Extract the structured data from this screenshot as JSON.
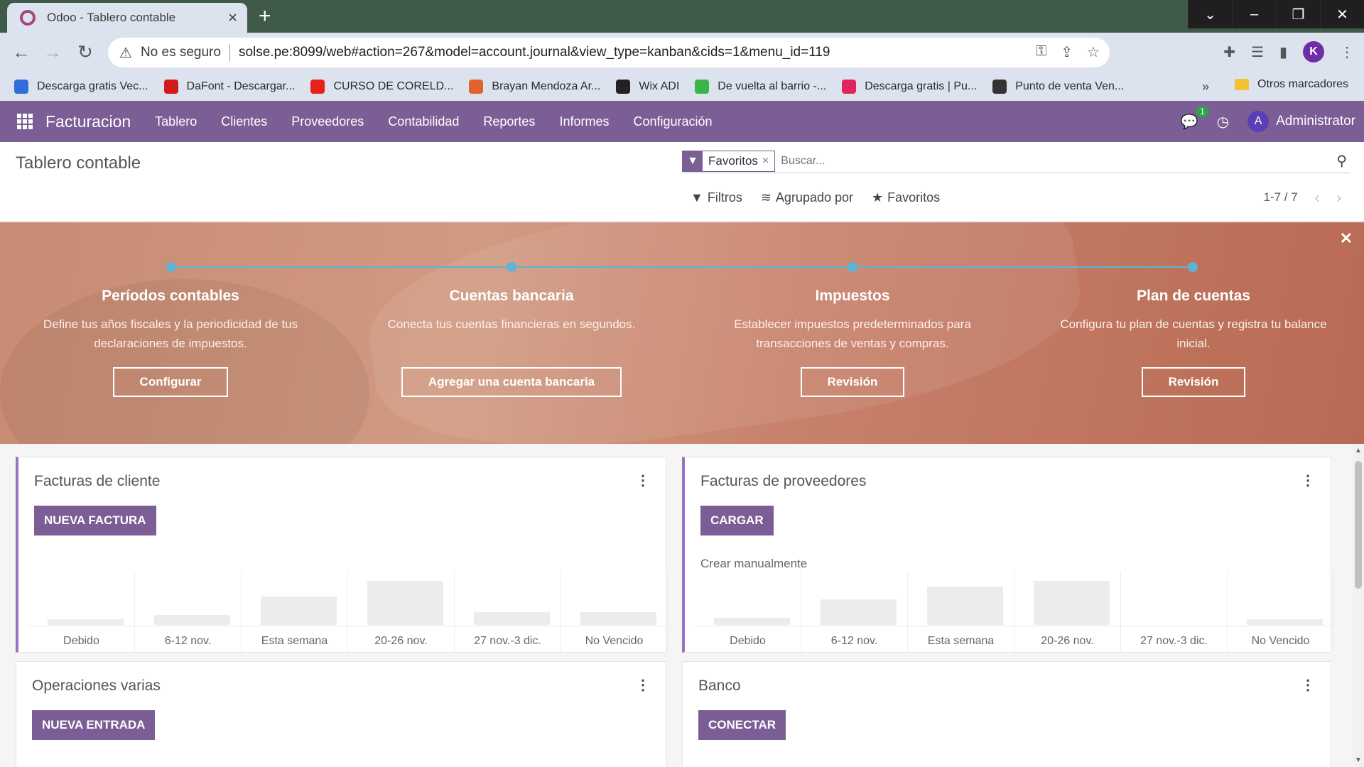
{
  "browser": {
    "tab_title": "Odoo - Tablero contable",
    "new_tab": "+",
    "insecure_label": "No es seguro",
    "url": "solse.pe:8099/web#action=267&model=account.journal&view_type=kanban&cids=1&menu_id=119",
    "profile_initial": "K",
    "bookmarks": [
      {
        "label": "Descarga gratis Vec...",
        "color": "#2d6fd6"
      },
      {
        "label": "DaFont - Descargar...",
        "color": "#d11b1b"
      },
      {
        "label": "CURSO DE CORELD...",
        "color": "#e62117"
      },
      {
        "label": "Brayan Mendoza Ar...",
        "color": "#e2622a"
      },
      {
        "label": "Wix ADI",
        "color": "#222222"
      },
      {
        "label": "De vuelta al barrio -...",
        "color": "#3bb34a"
      },
      {
        "label": "Descarga gratis | Pu...",
        "color": "#e0245e"
      },
      {
        "label": "Punto de venta Ven...",
        "color": "#333333"
      }
    ],
    "bookmarks_more": "»",
    "other_bookmarks": "Otros marcadores"
  },
  "navbar": {
    "brand": "Facturacion",
    "menu": [
      "Tablero",
      "Clientes",
      "Proveedores",
      "Contabilidad",
      "Reportes",
      "Informes",
      "Configuración"
    ],
    "chat_badge": "1",
    "user_initial": "A",
    "user_name": "Administrator",
    "color": "#7b5e95"
  },
  "control_panel": {
    "title": "Tablero contable",
    "facet_label": "Favoritos",
    "search_placeholder": "Buscar...",
    "filters": "Filtros",
    "group_by": "Agrupado por",
    "favorites": "Favoritos",
    "pager": "1-7 / 7"
  },
  "banner": {
    "steps": [
      {
        "title": "Períodos contables",
        "desc": "Define tus años fiscales y la periodicidad de tus declaraciones de impuestos.",
        "button": "Configurar"
      },
      {
        "title": "Cuentas bancaria",
        "desc": "Conecta tus cuentas financieras en segundos.",
        "button": "Agregar una cuenta bancaria"
      },
      {
        "title": "Impuestos",
        "desc": "Establecer impuestos predeterminados para transacciones de ventas y compras.",
        "button": "Revisión"
      },
      {
        "title": "Plan de cuentas",
        "desc": "Configura tu plan de cuentas y registra tu balance inicial.",
        "button": "Revisión"
      }
    ]
  },
  "cards": {
    "customer_invoices": {
      "title": "Facturas de cliente",
      "button": "NUEVA FACTURA",
      "graph": {
        "labels": [
          "Debido",
          "6-12 nov.",
          "Esta semana",
          "20-26 nov.",
          "27 nov.-3 dic.",
          "No Vencido"
        ],
        "values": [
          8,
          14,
          40,
          62,
          18,
          18
        ]
      }
    },
    "vendor_bills": {
      "title": "Facturas de proveedores",
      "button": "CARGAR",
      "link": "Crear manualmente",
      "graph": {
        "labels": [
          "Debido",
          "6-12 nov.",
          "Esta semana",
          "20-26 nov.",
          "27 nov.-3 dic.",
          "No Vencido"
        ],
        "values": [
          10,
          36,
          54,
          62,
          0,
          8
        ]
      }
    },
    "misc": {
      "title": "Operaciones varias",
      "button": "NUEVA ENTRADA"
    },
    "bank": {
      "title": "Banco",
      "button": "CONECTAR"
    }
  }
}
